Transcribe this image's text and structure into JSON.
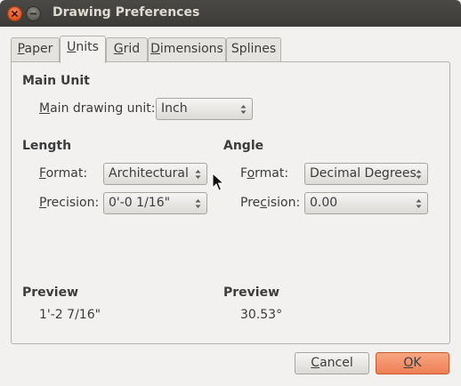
{
  "window": {
    "title": "Drawing Preferences"
  },
  "icons": {
    "close": "close-icon",
    "minimize": "minimize-icon",
    "combo_arrows": "updown-arrows-icon",
    "cursor": "mouse-cursor-icon"
  },
  "colors": {
    "titlebar": "#3c3b37",
    "close_button": "#e2521d",
    "ok_button": "#ef7f55",
    "background": "#f2f1f0"
  },
  "tabs": [
    {
      "label": "Paper",
      "mnemonic": "P",
      "rest": "aper",
      "active": false
    },
    {
      "label": "Units",
      "mnemonic": "U",
      "rest": "nits",
      "active": true
    },
    {
      "label": "Grid",
      "mnemonic": "G",
      "rest": "rid",
      "active": false
    },
    {
      "label": "Dimensions",
      "mnemonic": "D",
      "rest": "imensions",
      "active": false
    },
    {
      "label": "Splines",
      "mnemonic": "",
      "rest": "Splines",
      "active": false
    }
  ],
  "main_unit": {
    "heading": "Main Unit",
    "label_pre": "",
    "label_mn": "M",
    "label_post": "ain drawing unit:",
    "value": "Inch"
  },
  "length": {
    "heading": "Length",
    "format_pre": "",
    "format_mn": "F",
    "format_post": "ormat:",
    "format_value": "Architectural",
    "precision_pre": "",
    "precision_mn": "P",
    "precision_post": "recision:",
    "precision_value": "0'-0 1/16\"",
    "preview_heading": "Preview",
    "preview_value": "1'-2 7/16\""
  },
  "angle": {
    "heading": "Angle",
    "format_pre": "F",
    "format_mn": "o",
    "format_post": "rmat:",
    "format_value": "Decimal Degrees",
    "precision_pre": "Pre",
    "precision_mn": "c",
    "precision_post": "ision:",
    "precision_value": "0.00",
    "preview_heading": "Preview",
    "preview_value": "30.53°"
  },
  "buttons": {
    "cancel_mn": "C",
    "cancel_rest": "ancel",
    "ok_mn": "O",
    "ok_rest": "K"
  }
}
